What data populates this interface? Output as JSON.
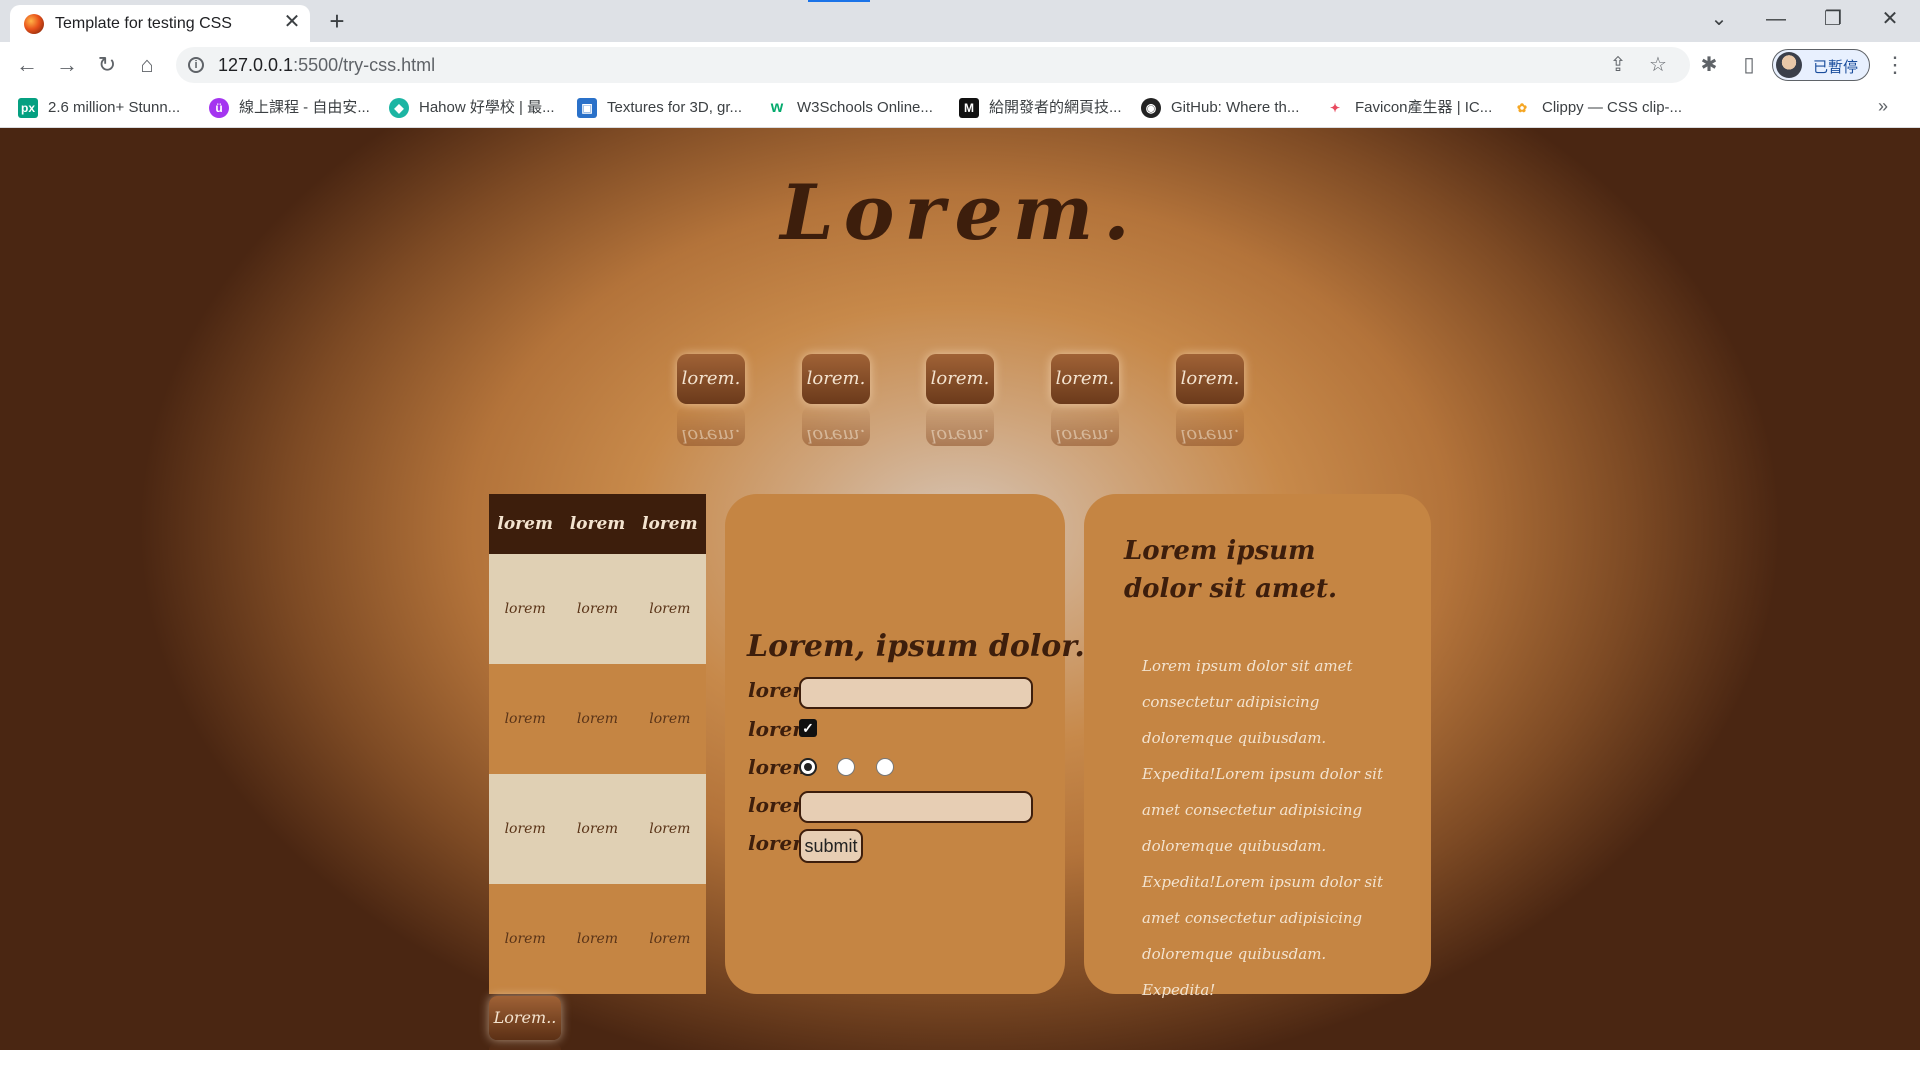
{
  "browser": {
    "tab_title": "Template for testing CSS",
    "url_host": "127.0.0.1",
    "url_rest": ":5500/try-css.html",
    "profile_label": "已暫停",
    "bookmarks": [
      {
        "label": "2.6 million+ Stunn...",
        "icon": "pexels-icon"
      },
      {
        "label": "線上課程 - 自由安...",
        "icon": "udemy-icon"
      },
      {
        "label": "Hahow 好學校 | 最...",
        "icon": "hahow-icon"
      },
      {
        "label": "Textures for 3D, gr...",
        "icon": "textures-icon"
      },
      {
        "label": "W3Schools Online...",
        "icon": "w3schools-icon"
      },
      {
        "label": "給開發者的網頁技...",
        "icon": "mdn-icon"
      },
      {
        "label": "GitHub: Where th...",
        "icon": "github-icon"
      },
      {
        "label": "Favicon產生器 | IC...",
        "icon": "favicon-icon"
      },
      {
        "label": "Clippy — CSS clip-...",
        "icon": "clippy-icon"
      }
    ]
  },
  "page": {
    "title": "Lorem.",
    "nav_buttons": [
      "lorem.",
      "lorem.",
      "lorem.",
      "lorem.",
      "lorem."
    ],
    "table": {
      "headers": [
        "lorem",
        "lorem",
        "lorem"
      ],
      "rows": [
        [
          "lorem",
          "lorem",
          "lorem"
        ],
        [
          "lorem",
          "lorem",
          "lorem"
        ],
        [
          "lorem",
          "lorem",
          "lorem"
        ],
        [
          "lorem",
          "lorem",
          "lorem"
        ]
      ]
    },
    "back_button": "Lorem..",
    "form": {
      "title": "Lorem, ipsum dolor.",
      "labels": [
        "lorem",
        "lorem",
        "lorem",
        "lorem",
        "lorem"
      ],
      "checkbox_checked": true,
      "submit_label": "submit"
    },
    "text_card": {
      "heading": "Lorem ipsum dolor sit amet.",
      "body": "Lorem ipsum dolor sit amet consectetur adipisicing doloremque quibusdam. Expedita!Lorem ipsum dolor sit amet consectetur adipisicing doloremque quibusdam. Expedita!Lorem ipsum dolor sit amet consectetur adipisicing doloremque quibusdam. Expedita!"
    }
  }
}
